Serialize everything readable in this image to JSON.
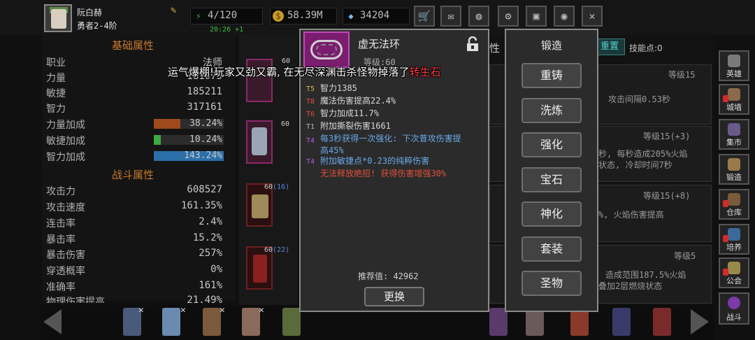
{
  "player": {
    "name": "阮白赫",
    "rank": "勇者2-4阶"
  },
  "resources": {
    "stamina": "4/120",
    "stamina_timer": "20:26 +1",
    "gold": "58.39M",
    "gems": "34204"
  },
  "left_panel": {
    "basic_title": "基础属性",
    "basic_stats": [
      {
        "label": "职业",
        "value": "法师"
      },
      {
        "label": "力量",
        "value": "181075"
      },
      {
        "label": "敏捷",
        "value": "185211"
      },
      {
        "label": "智力",
        "value": "317161"
      }
    ],
    "bonus_stats": [
      {
        "label": "力量加成",
        "value": "38.24%",
        "color": "#a04a1c",
        "fill": 0.3824
      },
      {
        "label": "敏捷加成",
        "value": "10.24%",
        "color": "#3fa83f",
        "fill": 0.1024
      },
      {
        "label": "智力加成",
        "value": "143.24%",
        "color": "#2c6fa8",
        "fill": 1.0
      }
    ],
    "combat_title": "战斗属性",
    "combat_stats": [
      {
        "label": "攻击力",
        "value": "608527"
      },
      {
        "label": "攻击速度",
        "value": "161.35%"
      },
      {
        "label": "连击率",
        "value": "2.4%"
      },
      {
        "label": "暴击率",
        "value": "15.2%"
      },
      {
        "label": "暴击伤害",
        "value": "257%"
      },
      {
        "label": "穿透概率",
        "value": "0%"
      },
      {
        "label": "准确率",
        "value": "161%"
      },
      {
        "label": "物理伤害提高",
        "value": "21.49%"
      }
    ]
  },
  "equipment": [
    {
      "level": "60",
      "extra": ""
    },
    {
      "level": "60",
      "extra": ""
    },
    {
      "level": "60",
      "extra": "(16)"
    },
    {
      "level": "60",
      "extra": "(22)"
    }
  ],
  "right_panel": {
    "tab_partial": "性",
    "reset_label": "重置",
    "skill_points": "技能点:0",
    "rows": [
      {
        "level": "等级15",
        "text": "攻击间隔0.53秒"
      },
      {
        "level": "等级15(+3)",
        "text": "秒, 每秒造成205%火焰",
        "text2": "状态, 冷却时间7秒"
      },
      {
        "level": "等级15(+8)",
        "text": "%, 火焰伤害提高"
      },
      {
        "level": "等级5",
        "text": "造成范围187.5%火焰",
        "text2": "叠加2层燃烧状态"
      }
    ]
  },
  "side_nav": [
    {
      "label": "英雄",
      "color": "#7a7a7a"
    },
    {
      "label": "城墙",
      "color": "#8a6a4a"
    },
    {
      "label": "集市",
      "color": "#6a5a8a"
    },
    {
      "label": "锻造",
      "color": "#9a7a4a"
    },
    {
      "label": "仓库",
      "color": "#7a5a3a"
    },
    {
      "label": "培养",
      "color": "#3a6a9a"
    },
    {
      "label": "公会",
      "color": "#9a8a4a"
    },
    {
      "label": "战斗",
      "color": "#7a3aaa"
    }
  ],
  "broadcast": {
    "text": "运气爆棚!玩家又劲又霸, 在无尽深渊击杀怪物掉落了",
    "highlight": "转生石",
    "highlight_color": "#ff3b3b"
  },
  "item": {
    "name": "虚无法环",
    "level": "等级:60",
    "affixes": [
      {
        "tier": "T5",
        "text": "智力1385",
        "color": "#d8d8d8",
        "tier_color": "#d8b24a"
      },
      {
        "tier": "T8",
        "text": "魔法伤害提高22.4%",
        "color": "#d8d8d8",
        "tier_color": "#e0503a"
      },
      {
        "tier": "T6",
        "text": "智力加成11.7%",
        "color": "#d8d8d8",
        "tier_color": "#e0503a"
      },
      {
        "tier": "T1",
        "text": "附加撕裂伤害1661",
        "color": "#d8d8d8",
        "tier_color": "#bbbbbb"
      },
      {
        "tier": "T4",
        "text": "每3秒获得一次强化: 下次普攻伤害提",
        "text2": "高45%",
        "color": "#6aa8e8",
        "tier_color": "#b45ae0"
      },
      {
        "tier": "T4",
        "text": "附加敏捷点*0.23的纯粹伤害",
        "color": "#6aa8e8",
        "tier_color": "#b45ae0"
      },
      {
        "tier": "",
        "text": "无法释放绝招! 获得伤害增强30%",
        "color": "#e0503a",
        "tier_color": "#e0503a"
      }
    ],
    "recommend": "推荐值: 42962",
    "replace_label": "更换"
  },
  "forge": {
    "title": "锻造",
    "buttons": [
      "重铸",
      "洗炼",
      "强化",
      "宝石",
      "神化",
      "套装",
      "圣物"
    ]
  },
  "heroes_x_mark": "✕",
  "icons": {
    "edit": "edit-icon",
    "stamina": "lightning-icon",
    "gold": "gold-coin-icon",
    "gem": "diamond-icon",
    "lock": "unlock-icon"
  }
}
